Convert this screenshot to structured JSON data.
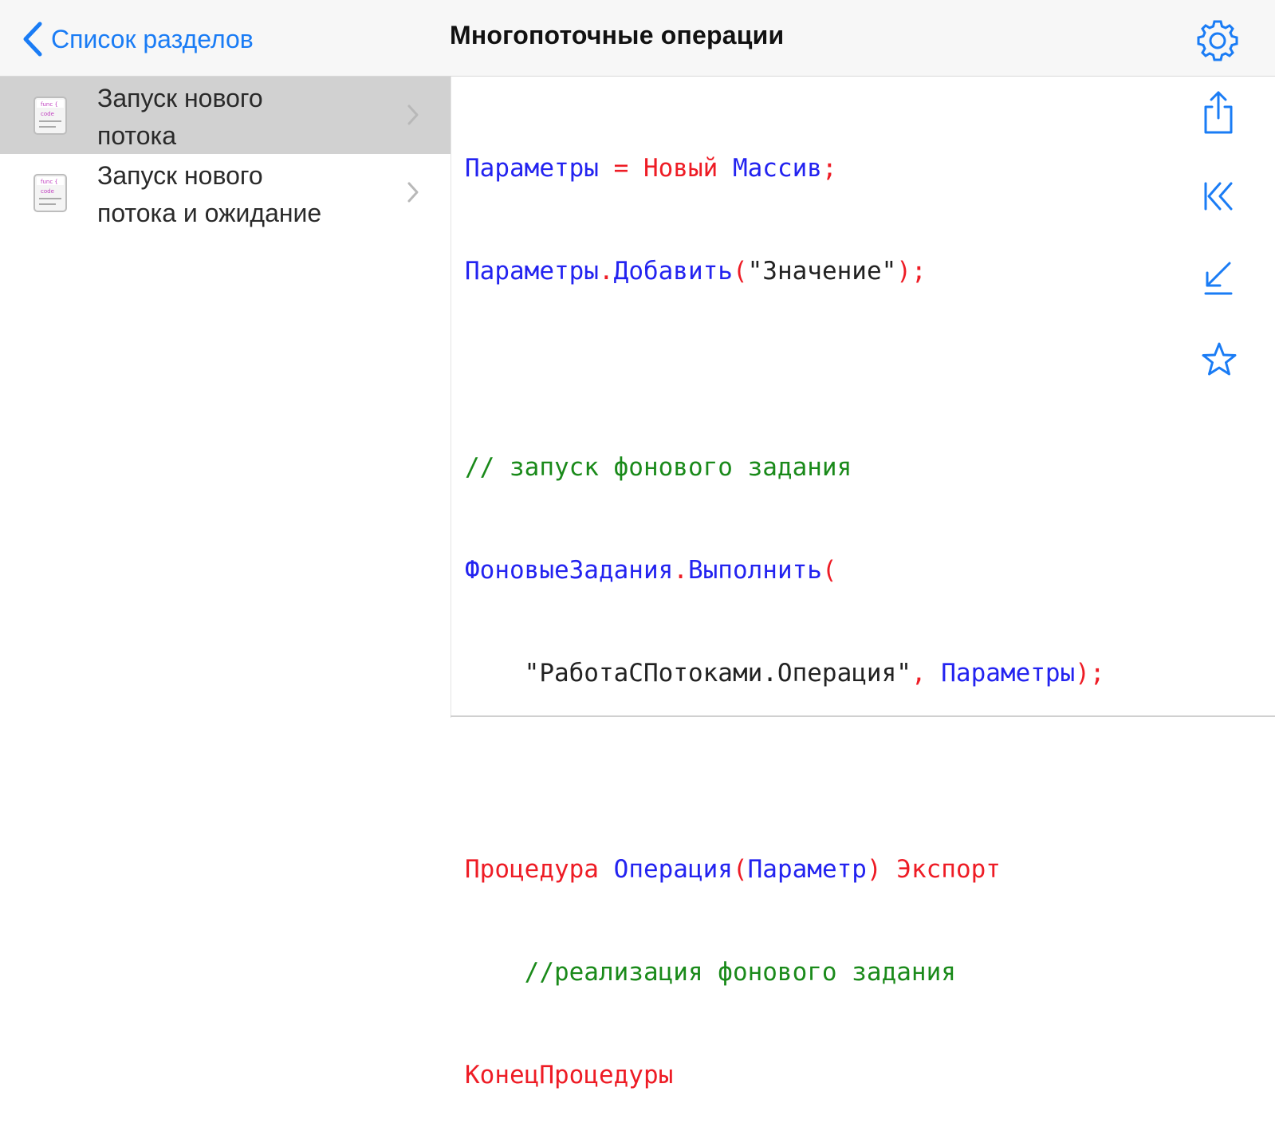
{
  "nav": {
    "back_label": "Список разделов",
    "title": "Многопоточные операции"
  },
  "sidebar": {
    "items": [
      {
        "line1": "Запуск нового",
        "line2": "потока",
        "selected": true
      },
      {
        "line1": "Запуск нового",
        "line2": "потока и ожидание",
        "selected": false
      }
    ]
  },
  "code": {
    "l1": {
      "a": "Параметры",
      "b": " = ",
      "c": "Новый",
      "d": " Массив",
      "e": ";"
    },
    "l2": {
      "a": "Параметры",
      "b": ".",
      "c": "Добавить",
      "d": "(",
      "e": "\"Значение\"",
      "f": ");"
    },
    "l3": {
      "a": "// запуск фонового задания"
    },
    "l4": {
      "a": "ФоновыеЗадания",
      "b": ".",
      "c": "Выполнить",
      "d": "("
    },
    "l5": {
      "a": "    \"РаботаСПотоками.Операция\"",
      "b": ", ",
      "c": "Параметры",
      "d": ");"
    },
    "l6": {
      "a": "Процедура",
      "b": " ",
      "c": "Операция",
      "d": "(",
      "e": "Параметр",
      "f": ")",
      "g": " Экспорт"
    },
    "l7": {
      "a": "    //реализация фонового задания"
    },
    "l8": {
      "a": "КонецПроцедуры"
    }
  },
  "toolbar": {
    "icons": [
      "share-icon",
      "first-page-icon",
      "collapse-icon",
      "favorite-star-icon"
    ]
  },
  "colors": {
    "accent": "#1a7cf5",
    "keyword": "#ee1c25",
    "identifier": "#2323f0",
    "comment": "#1a8a1a",
    "string": "#222222",
    "selected_row": "#d1d1d1"
  }
}
